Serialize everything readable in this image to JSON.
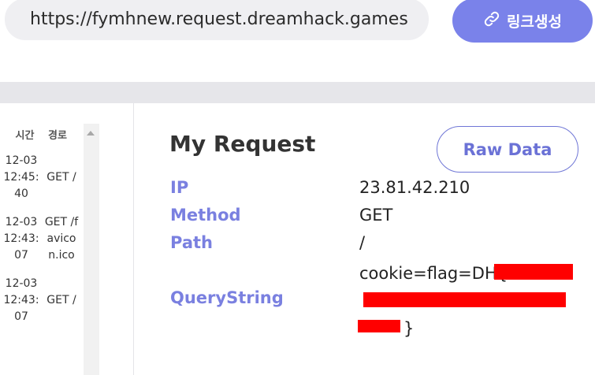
{
  "url_bar": {
    "value": "https://fymhnew.request.dreamhack.games"
  },
  "generate_button": {
    "label": "링크생성"
  },
  "sidebar": {
    "header_time": "시간",
    "header_path": "경로",
    "items": [
      {
        "time": "12-03\n12:45:\n40",
        "path": "GET /"
      },
      {
        "time": "12-03\n12:43:\n07",
        "path": "GET /f\navico\nn.ico"
      },
      {
        "time": "12-03\n12:43:\n07",
        "path": "GET /"
      }
    ]
  },
  "request": {
    "title": "My Request",
    "raw_button": "Raw Data",
    "fields": {
      "ip_label": "IP",
      "ip_value": "23.81.42.210",
      "method_label": "Method",
      "method_value": "GET",
      "path_label": "Path",
      "path_value": "/",
      "query_label": "QueryString",
      "query_line1": "cookie=flag=DH{",
      "query_line2": "",
      "query_line3": "}"
    }
  },
  "colors": {
    "accent": "#7a82ea",
    "label": "#7a80e0",
    "redaction": "#ff0000"
  }
}
